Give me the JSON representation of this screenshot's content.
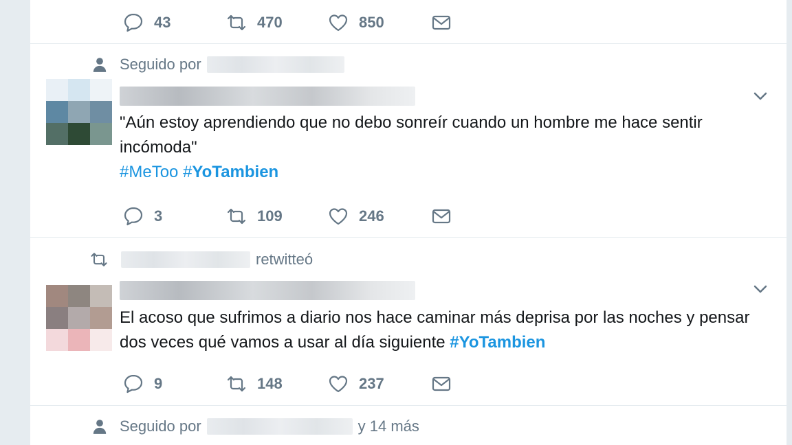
{
  "tweet_top": {
    "actions": {
      "replies": "43",
      "retweets": "470",
      "likes": "850"
    }
  },
  "tweet_1": {
    "context_label": "Seguido por",
    "text_quote": "\"Aún estoy aprendiendo que no debo sonreír cuando un hombre me hace sentir incómoda\"",
    "hashtag_1": "#MeToo",
    "hashtag_2_hash": "#",
    "hashtag_2_word": "YoTambien",
    "actions": {
      "replies": "3",
      "retweets": "109",
      "likes": "246"
    }
  },
  "tweet_2": {
    "context_label": "retwitteó",
    "text": "El acoso que sufrimos a diario nos hace caminar más deprisa por las noches y pensar dos veces qué vamos a usar al día siguiente ",
    "hashtag": "#YoTambien",
    "actions": {
      "replies": "9",
      "retweets": "148",
      "likes": "237"
    }
  },
  "tweet_bottom": {
    "context_label": "Seguido por",
    "context_suffix": "y 14 más"
  },
  "colors": {
    "accent": "#1b95e0",
    "muted": "#657786",
    "text": "#14171a",
    "background": "#e6ecf0"
  },
  "icons": [
    "reply-icon",
    "retweet-icon",
    "like-icon",
    "direct-message-icon",
    "person-icon",
    "chevron-down-icon"
  ]
}
